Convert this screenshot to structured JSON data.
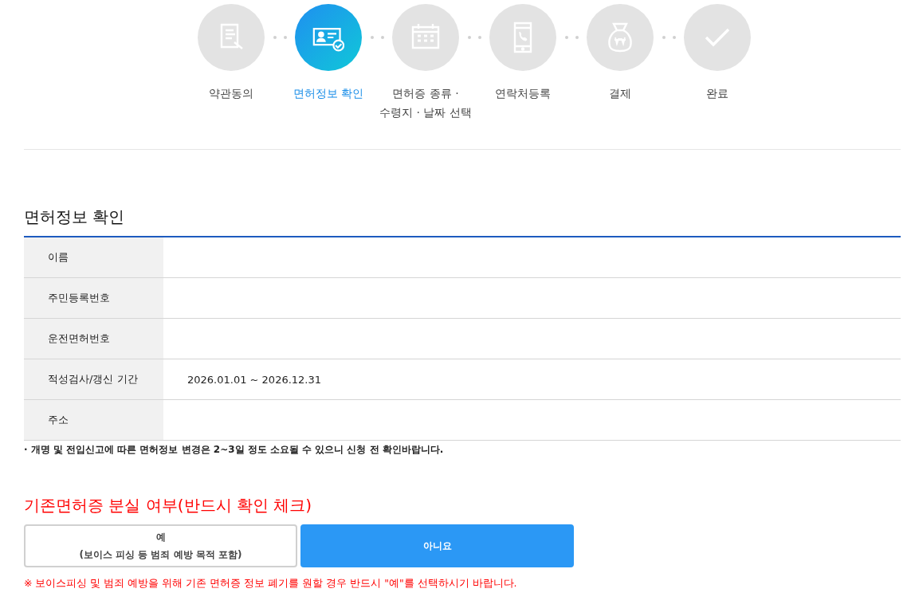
{
  "steps": [
    {
      "kind": "document",
      "label": "약관동의",
      "selected": false
    },
    {
      "kind": "id-card",
      "label": "면허정보 확인",
      "selected": true
    },
    {
      "kind": "calendar",
      "label": "면허증 종류 ·\n수령지 · 날짜 선택",
      "selected": false
    },
    {
      "kind": "phone",
      "label": "연락처등록",
      "selected": false
    },
    {
      "kind": "money-bag",
      "label": "결제",
      "selected": false
    },
    {
      "kind": "check",
      "label": "완료",
      "selected": false
    }
  ],
  "section_title": "면허정보 확인",
  "info_rows": [
    {
      "label": "이름"
    },
    {
      "label": "주민등록번호"
    },
    {
      "label": "운전면허번호"
    },
    {
      "label": "적성검사/갱신 기간",
      "value": "2026.01.01 ~ 2026.12.31"
    },
    {
      "label": "주소"
    }
  ],
  "info_note": "· 개명 및 전입신고에 따른 면허정보 변경은 2~3일 정도 소요될 수 있으니 신청 전 확인바랍니다.",
  "loss_title": "기존면허증 분실 여부(반드시 확인 체크)",
  "loss_options": [
    {
      "lines": [
        "예",
        "(보이스 피싱 등 범죄 예방 목적 포함)"
      ],
      "selected": false
    },
    {
      "lines": [
        "아니요"
      ],
      "selected": true
    }
  ],
  "loss_note": "※ 보이스피싱 및 범죄 예방을 위해 기존 면허증 정보 폐기를 원할 경우 반드시 \"예\"를 선택하시기 바랍니다."
}
